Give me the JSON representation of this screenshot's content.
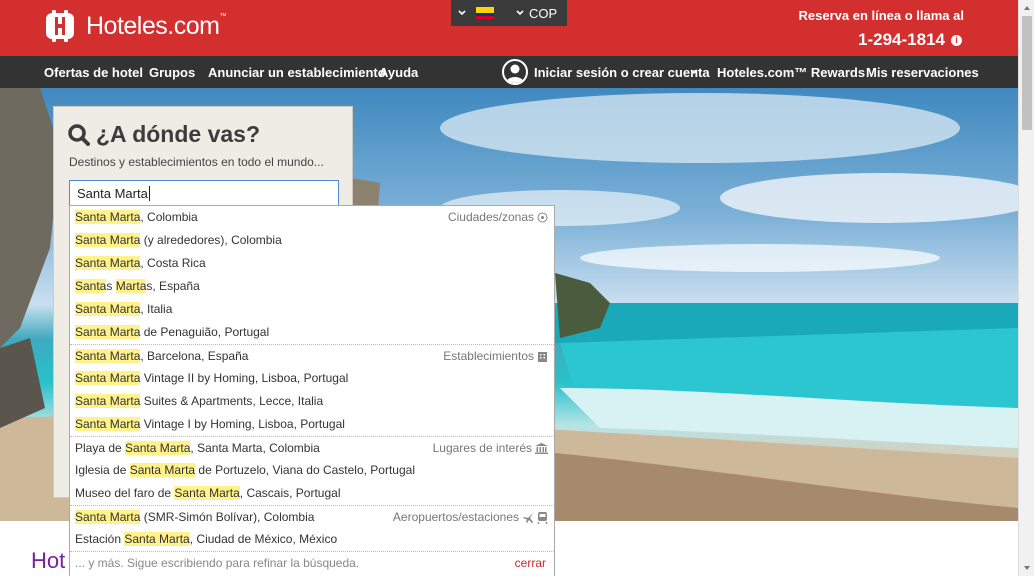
{
  "brand": {
    "name": "Hoteles.com",
    "tm": "™"
  },
  "locale": {
    "currency": "COP"
  },
  "contact": {
    "label": "Reserva en línea o llama al",
    "phone": "1-294-1814"
  },
  "nav": {
    "offers": "Ofertas de hotel",
    "groups": "Grupos",
    "advertise": "Anunciar un establecimiento",
    "help": "Ayuda",
    "signin": "Iniciar sesión o crear cuenta",
    "rewards": "Hoteles.com™ Rewards",
    "reservations": "Mis reservaciones"
  },
  "search": {
    "title": "¿A dónde vas?",
    "subtitle": "Destinos y establecimientos en todo el mundo...",
    "value": "Santa Marta"
  },
  "suggestions": {
    "cities": {
      "label": "Ciudades/zonas",
      "items": [
        {
          "hl": "Santa Marta",
          "rest": ", Colombia"
        },
        {
          "hl": "Santa Marta",
          "rest": " (y alrededores), Colombia"
        },
        {
          "hl": "Santa Marta",
          "rest": ", Costa Rica"
        },
        {
          "parts": [
            "Santa",
            "s ",
            "Marta",
            "s, España"
          ]
        },
        {
          "hl": "Santa Marta",
          "rest": ", Italia"
        },
        {
          "hl": "Santa Marta",
          "rest": " de Penaguião, Portugal"
        }
      ]
    },
    "properties": {
      "label": "Establecimientos",
      "items": [
        {
          "hl": "Santa Marta",
          "rest": ", Barcelona, España"
        },
        {
          "hl": "Santa Marta",
          "rest": " Vintage II by Homing, Lisboa, Portugal"
        },
        {
          "hl": "Santa Marta",
          "rest": " Suites & Apartments, Lecce, Italia"
        },
        {
          "hl": "Santa Marta",
          "rest": " Vintage I by Homing, Lisboa, Portugal"
        }
      ]
    },
    "landmarks": {
      "label": "Lugares de interés",
      "items": [
        {
          "pre": "Playa de ",
          "hl": "Santa Marta",
          "rest": ", Santa Marta, Colombia"
        },
        {
          "pre": "Iglesia de ",
          "hl": "Santa Marta",
          "rest": " de Portuzelo, Viana do Castelo, Portugal"
        },
        {
          "pre": "Museo del faro de ",
          "hl": "Santa Marta",
          "rest": ", Cascais, Portugal"
        }
      ]
    },
    "airports": {
      "label": "Aeropuertos/estaciones",
      "items": [
        {
          "hl": "Santa Marta",
          "rest": " (SMR-Simón Bolívar), Colombia"
        },
        {
          "pre": "Estación ",
          "hl": "Santa Marta",
          "rest": ", Ciudad de México, México"
        }
      ]
    },
    "more": "... y más. Sigue escribiendo para refinar la búsqueda.",
    "close": "cerrar"
  },
  "section": {
    "heading_partial": "Hot"
  },
  "colors": {
    "brand_red": "#d32f2f",
    "nav_dark": "#333333",
    "highlight": "#fff28a",
    "accent_purple": "#7b1fa2"
  }
}
